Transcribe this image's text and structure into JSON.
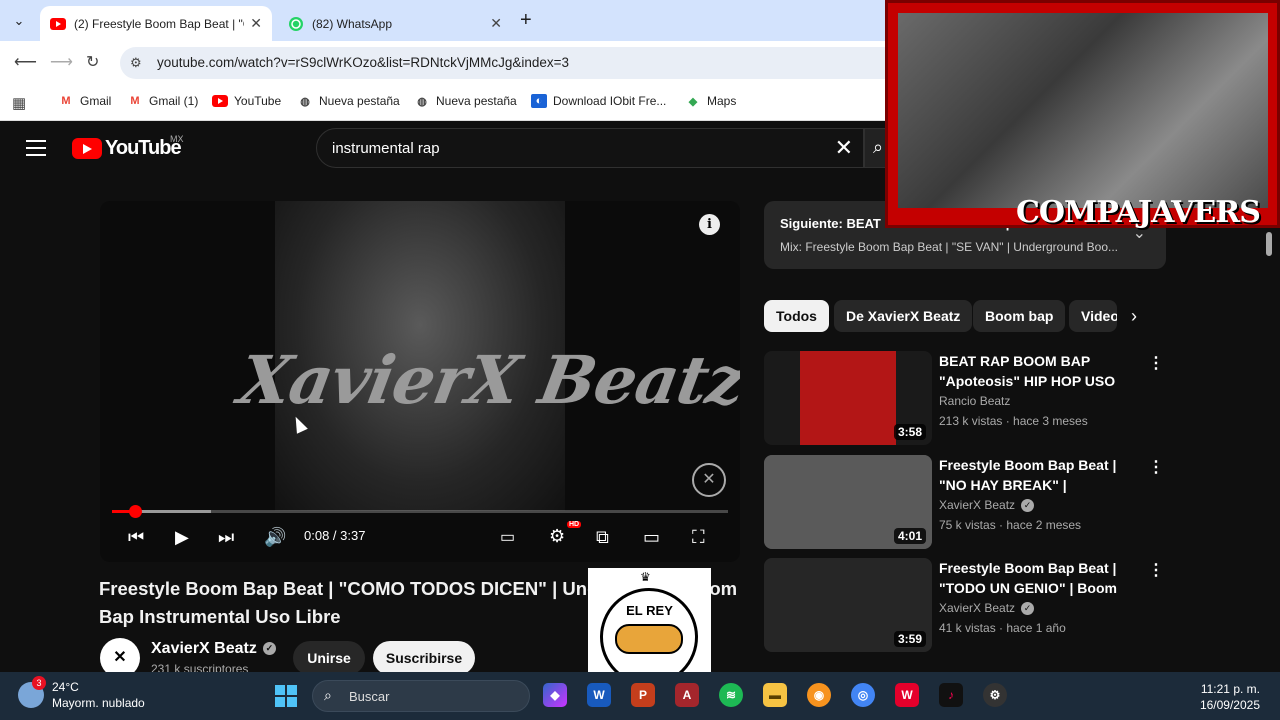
{
  "browser": {
    "tabs": [
      {
        "title": "(2) Freestyle Boom Bap Beat | \"C",
        "active": true,
        "icon": "youtube-icon"
      },
      {
        "title": "(82) WhatsApp",
        "active": false,
        "icon": "whatsapp-icon"
      }
    ],
    "url_site_icon": "site-info-icon",
    "url": "youtube.com/watch?v=rS9clWrKOzo&list=RDNtckVjMMcJg&index=3",
    "bookmarks": [
      {
        "label": "Gmail",
        "icon": "gmail-icon"
      },
      {
        "label": "Gmail (1)",
        "icon": "gmail-icon"
      },
      {
        "label": "YouTube",
        "icon": "youtube-icon"
      },
      {
        "label": "Nueva pestaña",
        "icon": "globe-icon"
      },
      {
        "label": "Nueva pestaña",
        "icon": "globe-icon"
      },
      {
        "label": "Download IObit Fre...",
        "icon": "iobit-icon"
      },
      {
        "label": "Maps",
        "icon": "maps-icon"
      }
    ]
  },
  "youtube": {
    "logo_text": "YouTube",
    "country": "MX",
    "search_value": "instrumental rap",
    "player": {
      "brand_text": "XavierX Beatz",
      "time": "0:08 / 3:37",
      "played_fraction": 0.037,
      "buffered_fraction": 0.16,
      "hd_badge": "HD"
    },
    "video_title": "Freestyle Boom Bap Beat | \"COMO TODOS DICEN\" | Underground Boom Bap Instrumental Uso Libre",
    "channel": {
      "name": "XavierX Beatz",
      "subs": "231 k suscriptores"
    },
    "join_label": "Unirse",
    "subscribe_label": "Suscribirse",
    "next_up": {
      "line1": "Siguiente: BEAT RAP BOOM BAP \"Apoteosis\"",
      "line2": "Mix: Freestyle Boom Bap Beat | \"SE VAN\" | Underground Boo..."
    },
    "chips": [
      "Todos",
      "De XavierX Beatz",
      "Boom bap",
      "Videos"
    ],
    "recommendations": [
      {
        "title": "BEAT RAP BOOM BAP \"Apoteosis\" HIP HOP USO LIB...",
        "channel": "Rancio Beatz",
        "verified": false,
        "meta": "213 k vistas · hace 3 meses",
        "duration": "3:58",
        "thumb": "#b31616"
      },
      {
        "title": "Freestyle Boom Bap Beat | \"NO HAY BREAK\" | Underground ...",
        "channel": "XavierX Beatz",
        "verified": true,
        "meta": "75 k vistas · hace 2 meses",
        "duration": "4:01",
        "thumb": "#5a5a5a"
      },
      {
        "title": "Freestyle Boom Bap Beat | \"TODO UN GENIO\" | Boom Bap ...",
        "channel": "XavierX Beatz",
        "verified": true,
        "meta": "41 k vistas · hace 1 año",
        "duration": "3:59",
        "thumb": "#262626"
      }
    ]
  },
  "overlays": {
    "stream_brand": "COMPAJAVERS",
    "sponsor_name": "EL REY"
  },
  "taskbar": {
    "weather_temp": "24°C",
    "weather_desc": "Mayorm. nublado",
    "weather_badge": "3",
    "search_placeholder": "Buscar",
    "time": "11:21 p. m.",
    "date": "16/09/2025"
  },
  "colors": {
    "accent": "#ff0000",
    "tab_strip": "#d3e3fd",
    "yt_bg": "#0f0f0f"
  }
}
